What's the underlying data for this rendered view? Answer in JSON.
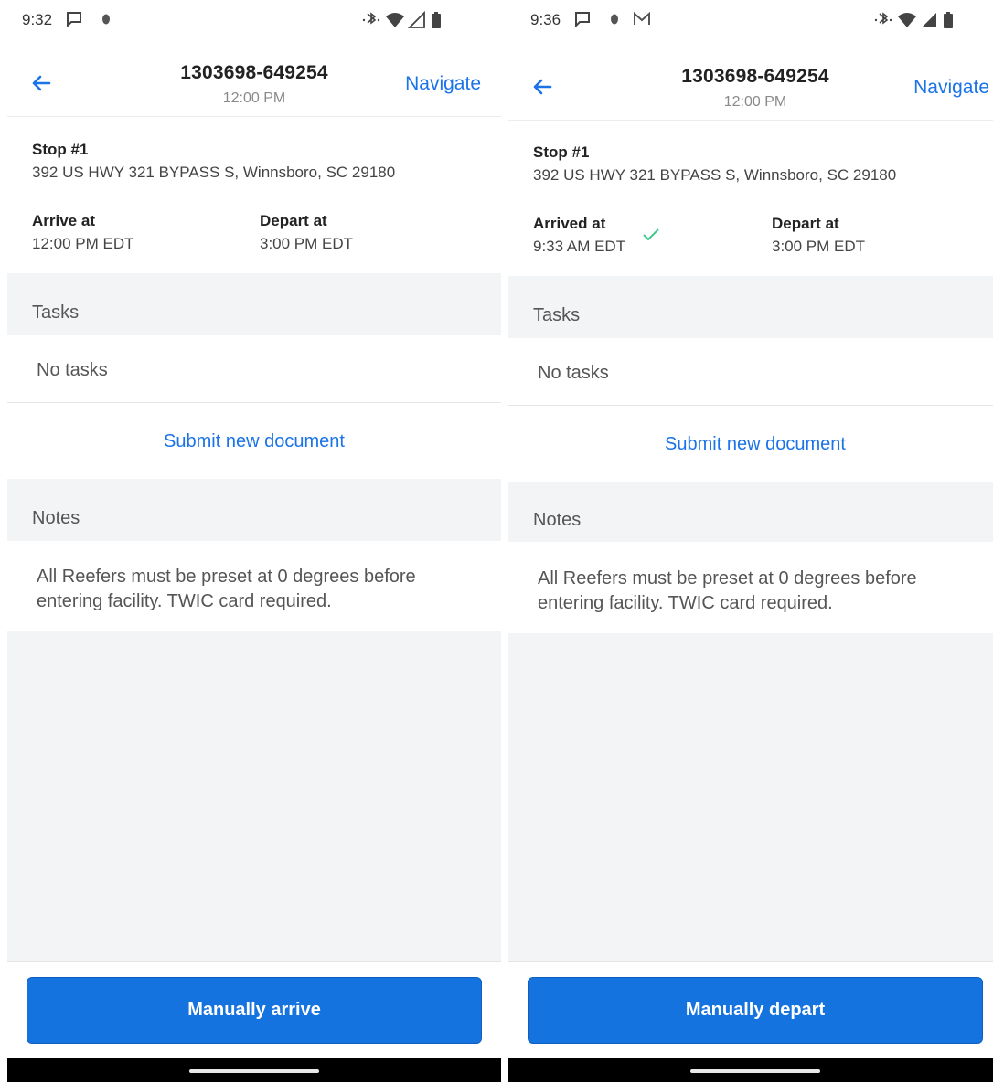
{
  "screens": [
    {
      "status_time": "9:32",
      "title": "1303698-649254",
      "subtitle": "12:00 PM",
      "navigate_label": "Navigate",
      "stop_label": "Stop #1",
      "address": "392 US HWY 321 BYPASS S, Winnsboro, SC 29180",
      "arrive_label": "Arrive at",
      "arrive_time": "12:00 PM EDT",
      "arrived_check": false,
      "depart_label": "Depart at",
      "depart_time": "3:00 PM EDT",
      "tasks_header": "Tasks",
      "tasks_empty": "No tasks",
      "submit_label": "Submit new document",
      "notes_header": "Notes",
      "notes_text": "All Reefers must be preset at 0 degrees before entering facility.   TWIC card required.",
      "action_button": "Manually arrive",
      "status_icons": [
        "chat-icon",
        "app-icon",
        "bluetooth-icon",
        "wifi-icon",
        "signal-icon",
        "battery-icon"
      ]
    },
    {
      "status_time": "9:36",
      "title": "1303698-649254",
      "subtitle": "12:00 PM",
      "navigate_label": "Navigate",
      "stop_label": "Stop #1",
      "address": "392 US HWY 321 BYPASS S, Winnsboro, SC 29180",
      "arrive_label": "Arrived at",
      "arrive_time": "9:33 AM EDT",
      "arrived_check": true,
      "depart_label": "Depart at",
      "depart_time": "3:00 PM EDT",
      "tasks_header": "Tasks",
      "tasks_empty": "No tasks",
      "submit_label": "Submit new document",
      "notes_header": "Notes",
      "notes_text": "All Reefers must be preset at 0 degrees before entering facility.   TWIC card required.",
      "action_button": "Manually depart",
      "status_icons": [
        "chat-icon",
        "app-icon",
        "gmail-icon",
        "bluetooth-icon",
        "wifi-icon",
        "signal-icon",
        "battery-icon"
      ]
    }
  ],
  "colors": {
    "accent": "#1a73e8",
    "button": "#1573e0",
    "band": "#f3f4f6",
    "check": "#3cc98a"
  }
}
